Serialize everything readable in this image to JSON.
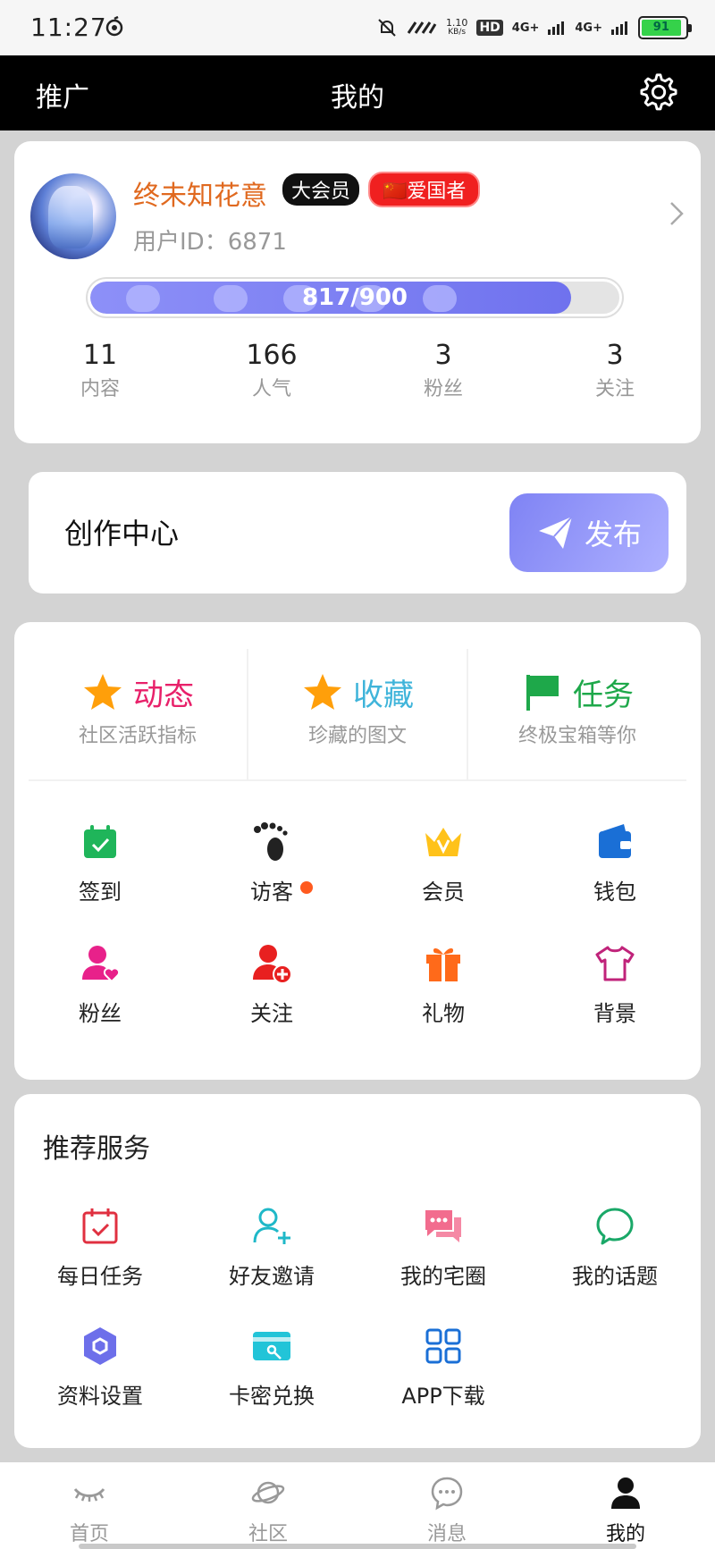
{
  "status_bar": {
    "time": "11:27",
    "net_speed": "1.10",
    "net_unit": "KB/s",
    "hd": "HD",
    "net1": "4G+",
    "net2": "4G+",
    "battery": "91"
  },
  "header": {
    "left_label": "推广",
    "title": "我的",
    "settings_icon": "gear-icon"
  },
  "profile": {
    "username": "终未知花意",
    "vip_badge": "大会员",
    "patriot_badge": "🇨🇳爱国者",
    "user_id": "用户ID：6871",
    "exp_text": "817/900",
    "exp_progress": 0.908,
    "stats": [
      {
        "value": "11",
        "label": "内容"
      },
      {
        "value": "166",
        "label": "人气"
      },
      {
        "value": "3",
        "label": "粉丝"
      },
      {
        "value": "3",
        "label": "关注"
      }
    ]
  },
  "create_center": {
    "title": "创作中心",
    "publish_label": "发布"
  },
  "features": [
    {
      "title": "动态",
      "subtitle": "社区活跃指标",
      "color": "#e8216a",
      "icon": "star-icon"
    },
    {
      "title": "收藏",
      "subtitle": "珍藏的图文",
      "color": "#3fb4da",
      "icon": "star-icon"
    },
    {
      "title": "任务",
      "subtitle": "终极宝箱等你",
      "color": "#1ea84a",
      "icon": "flag-icon"
    }
  ],
  "grid_row1": [
    {
      "label": "签到",
      "icon": "calendar-check-icon"
    },
    {
      "label": "访客",
      "icon": "footprint-icon"
    },
    {
      "label": "会员",
      "icon": "crown-icon"
    },
    {
      "label": "钱包",
      "icon": "wallet-icon"
    }
  ],
  "grid_row2": [
    {
      "label": "粉丝",
      "icon": "user-heart-icon"
    },
    {
      "label": "关注",
      "icon": "user-add-icon"
    },
    {
      "label": "礼物",
      "icon": "gift-icon"
    },
    {
      "label": "背景",
      "icon": "tshirt-icon"
    }
  ],
  "services": {
    "title": "推荐服务",
    "row1": [
      {
        "label": "每日任务",
        "icon": "calendar-task-icon"
      },
      {
        "label": "好友邀请",
        "icon": "invite-user-icon"
      },
      {
        "label": "我的宅圈",
        "icon": "chat-bubbles-icon"
      },
      {
        "label": "我的话题",
        "icon": "chat-circle-icon"
      }
    ],
    "row2": [
      {
        "label": "资料设置",
        "icon": "hexagon-settings-icon"
      },
      {
        "label": "卡密兑换",
        "icon": "card-key-icon"
      },
      {
        "label": "APP下载",
        "icon": "grid-apps-icon"
      }
    ]
  },
  "bottom_nav": [
    {
      "label": "首页",
      "icon": "eye-lashes-icon"
    },
    {
      "label": "社区",
      "icon": "planet-icon"
    },
    {
      "label": "消息",
      "icon": "message-icon"
    },
    {
      "label": "我的",
      "icon": "person-icon",
      "active": true
    }
  ]
}
